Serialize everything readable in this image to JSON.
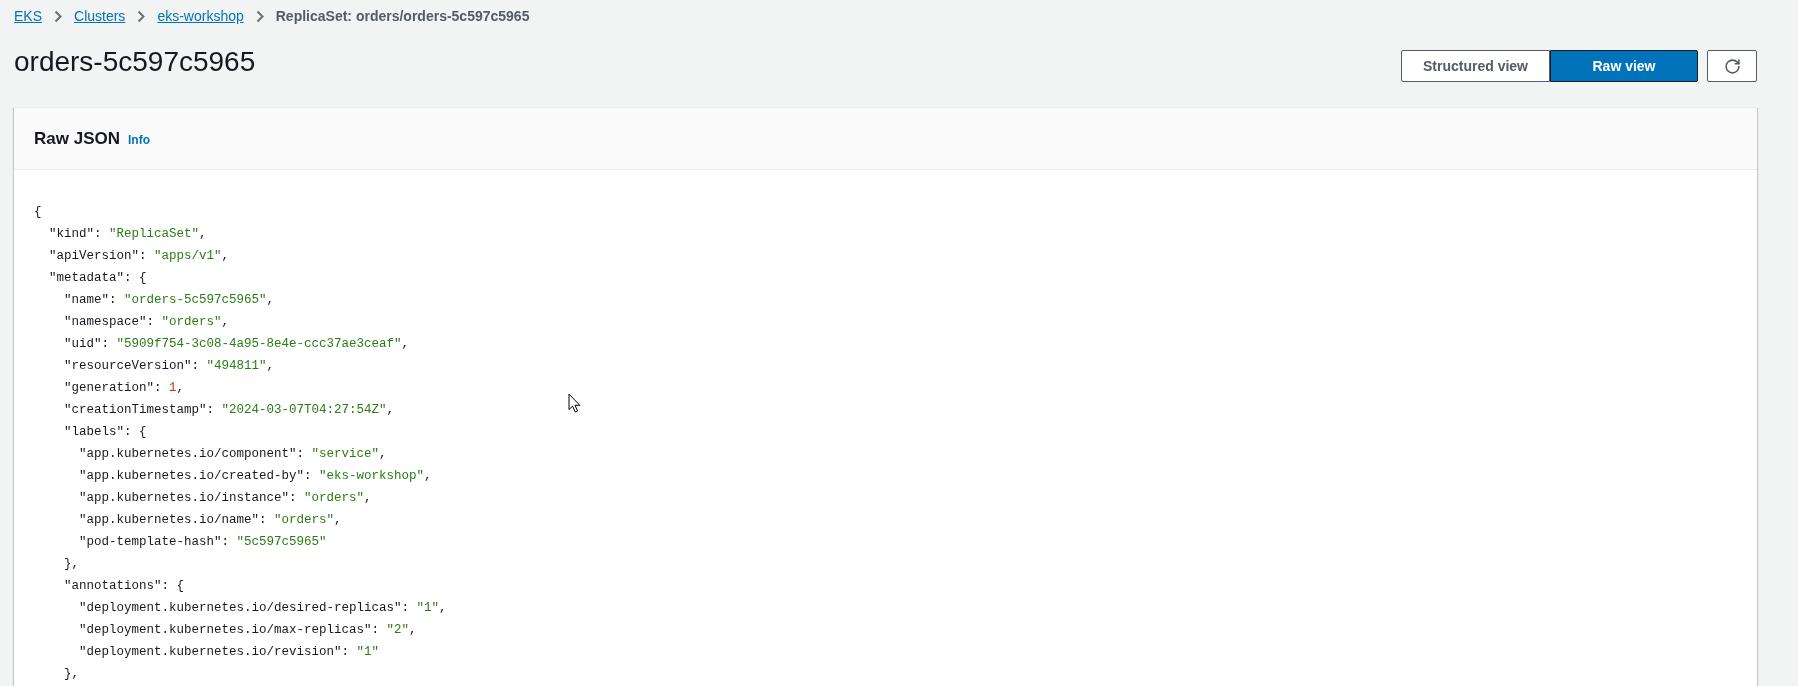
{
  "breadcrumbs": [
    {
      "label": "EKS",
      "current": false
    },
    {
      "label": "Clusters",
      "current": false
    },
    {
      "label": "eks-workshop",
      "current": false
    },
    {
      "label": "ReplicaSet: orders/orders-5c597c5965",
      "current": true
    }
  ],
  "page": {
    "title": "orders-5c597c5965"
  },
  "view_toggle": [
    {
      "label": "Structured view",
      "selected": false
    },
    {
      "label": "Raw view",
      "selected": true
    }
  ],
  "panel": {
    "title": "Raw JSON",
    "info_link": "Info",
    "json": {
      "open": "{",
      "children": [
        {
          "kind": "string",
          "key": "\"kind\":",
          "value": "\"ReplicaSet\"",
          "tail": ","
        },
        {
          "kind": "string",
          "key": "\"apiVersion\":",
          "value": "\"apps/v1\"",
          "tail": ","
        },
        {
          "kind": "object",
          "key": "\"metadata\":",
          "open": "{",
          "children": [
            {
              "kind": "string",
              "key": "\"name\":",
              "value": "\"orders-5c597c5965\"",
              "tail": ","
            },
            {
              "kind": "string",
              "key": "\"namespace\":",
              "value": "\"orders\"",
              "tail": ","
            },
            {
              "kind": "string",
              "key": "\"uid\":",
              "value": "\"5909f754-3c08-4a95-8e4e-ccc37ae3ceaf\"",
              "tail": ","
            },
            {
              "kind": "string",
              "key": "\"resourceVersion\":",
              "value": "\"494811\"",
              "tail": ","
            },
            {
              "kind": "number",
              "key": "\"generation\":",
              "value": "1",
              "tail": ","
            },
            {
              "kind": "string",
              "key": "\"creationTimestamp\":",
              "value": "\"2024-03-07T04:27:54Z\"",
              "tail": ","
            },
            {
              "kind": "object",
              "key": "\"labels\":",
              "open": "{",
              "close": "},",
              "children": [
                {
                  "kind": "string",
                  "key": "\"app.kubernetes.io/component\":",
                  "value": "\"service\"",
                  "tail": ","
                },
                {
                  "kind": "string",
                  "key": "\"app.kubernetes.io/created-by\":",
                  "value": "\"eks-workshop\"",
                  "tail": ","
                },
                {
                  "kind": "string",
                  "key": "\"app.kubernetes.io/instance\":",
                  "value": "\"orders\"",
                  "tail": ","
                },
                {
                  "kind": "string",
                  "key": "\"app.kubernetes.io/name\":",
                  "value": "\"orders\"",
                  "tail": ","
                },
                {
                  "kind": "string",
                  "key": "\"pod-template-hash\":",
                  "value": "\"5c597c5965\""
                }
              ]
            },
            {
              "kind": "object",
              "key": "\"annotations\":",
              "open": "{",
              "close": "},",
              "children": [
                {
                  "kind": "string",
                  "key": "\"deployment.kubernetes.io/desired-replicas\":",
                  "value": "\"1\"",
                  "tail": ","
                },
                {
                  "kind": "string",
                  "key": "\"deployment.kubernetes.io/max-replicas\":",
                  "value": "\"2\"",
                  "tail": ","
                },
                {
                  "kind": "string",
                  "key": "\"deployment.kubernetes.io/revision\":",
                  "value": "\"1\""
                }
              ]
            }
          ]
        }
      ]
    }
  }
}
